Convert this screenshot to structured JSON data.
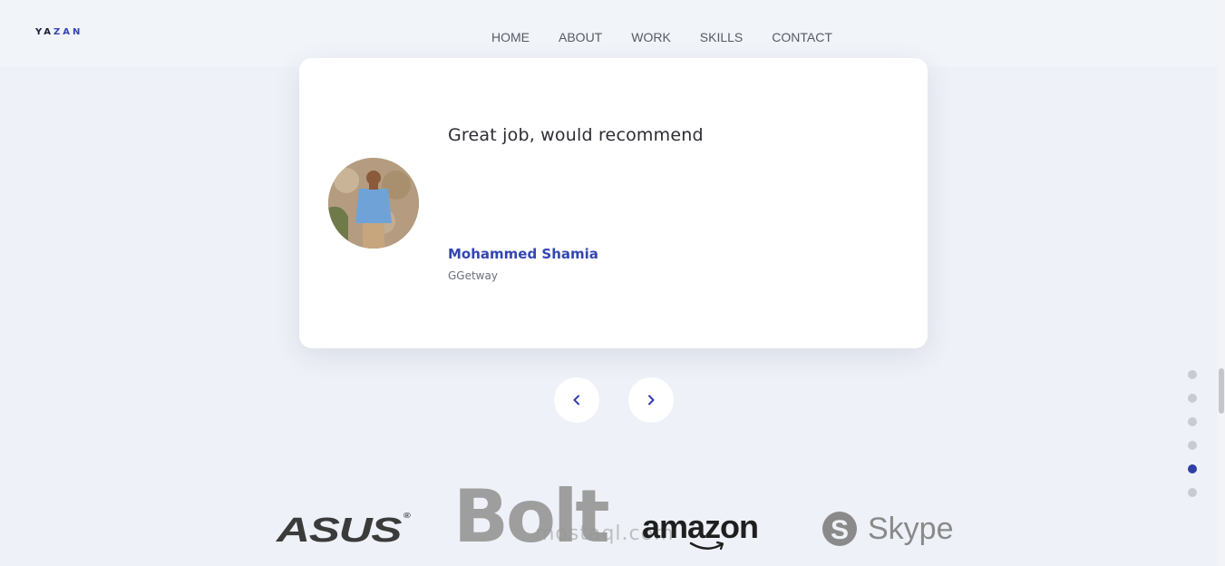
{
  "header": {
    "logo": {
      "left": "YA",
      "accent": "ZAN"
    },
    "nav": [
      "HOME",
      "ABOUT",
      "WORK",
      "SKILLS",
      "CONTACT"
    ]
  },
  "testimonial": {
    "quote": "Great job, would recommend",
    "name": "Mohammed Shamia",
    "company": "GGetway"
  },
  "carousel": {
    "prev_icon": "chevron-left-icon",
    "next_icon": "chevron-right-icon"
  },
  "side_nav": {
    "count": 6,
    "active_index": 4
  },
  "brands": {
    "asus": "ASUS",
    "bolt": "Bolt",
    "watermark": "mostaql.com",
    "amazon": "amazon",
    "skype": "Skype"
  },
  "colors": {
    "accent": "#3346b2",
    "background": "#eef1f7",
    "card": "#ffffff",
    "dot_active": "#2e3fa6",
    "dot_inactive": "#c9cbd1"
  }
}
